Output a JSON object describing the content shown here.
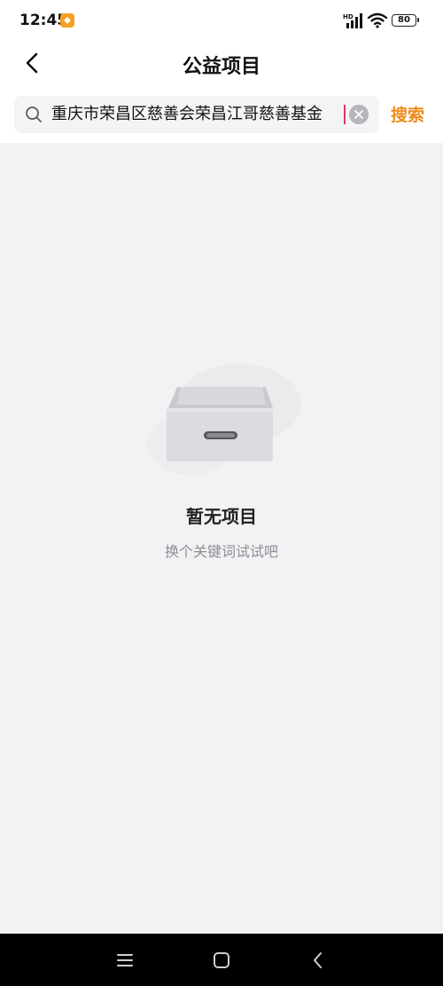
{
  "status_bar": {
    "time": "12:45",
    "network_label": "HD",
    "battery": "80"
  },
  "header": {
    "title": "公益项目"
  },
  "search": {
    "value": "重庆市荣昌区慈善会荣昌江哥慈善基金",
    "button_label": "搜索"
  },
  "empty_state": {
    "title": "暂无项目",
    "subtitle": "换个关键词试试吧"
  },
  "colors": {
    "accent": "#f08a1c",
    "caret": "#e2336b",
    "background": "#f2f2f4"
  },
  "system_nav": {
    "icons": [
      "menu-icon",
      "home-icon",
      "back-icon"
    ]
  }
}
